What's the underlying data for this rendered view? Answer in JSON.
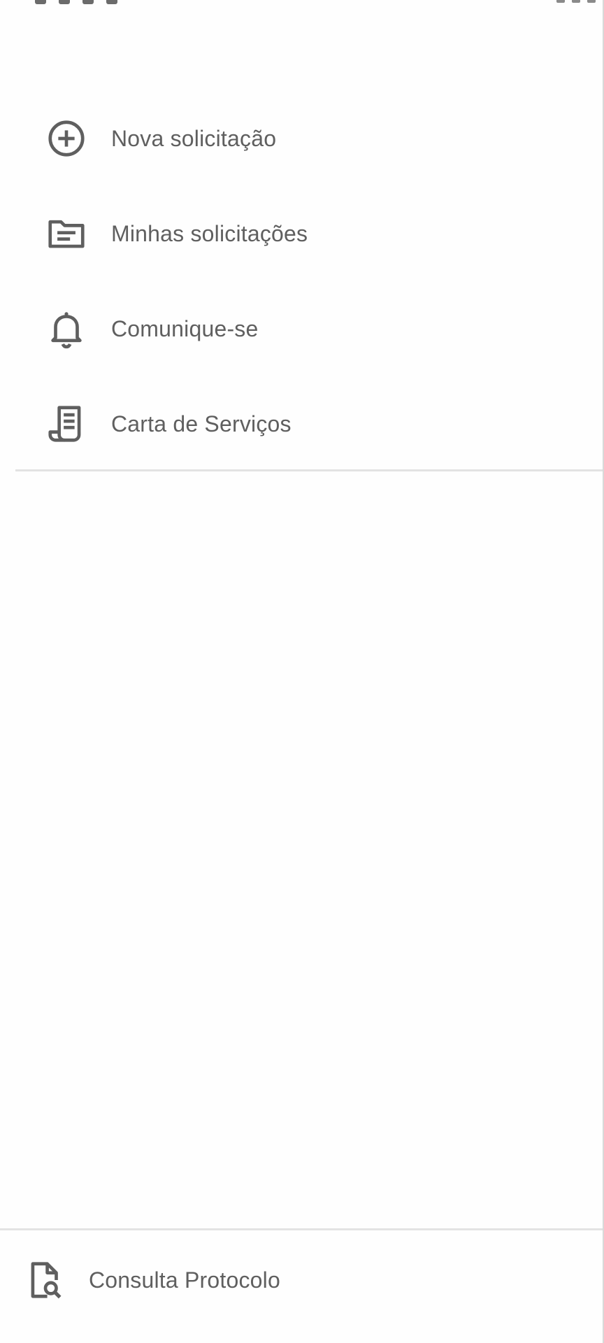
{
  "menu": {
    "items": [
      {
        "label": "Nova solicitação",
        "icon": "add-circle-icon"
      },
      {
        "label": "Minhas solicitações",
        "icon": "folder-icon"
      },
      {
        "label": "Comunique-se",
        "icon": "bell-icon"
      },
      {
        "label": "Carta de Serviços",
        "icon": "receipt-long-icon"
      }
    ]
  },
  "footer": {
    "label": "Consulta Protocolo",
    "icon": "document-search-icon"
  },
  "colors": {
    "icon": "#5f5f5f",
    "text": "#5f5f5f",
    "divider": "#e3e3e3",
    "background": "#fefefe"
  }
}
